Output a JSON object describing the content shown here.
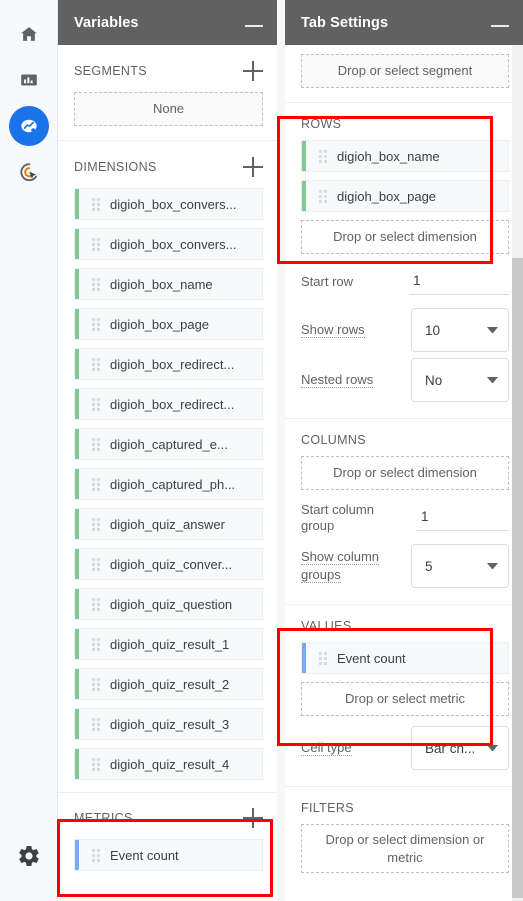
{
  "rail": {
    "items": [
      {
        "name": "home-icon",
        "label": "Home",
        "active": false
      },
      {
        "name": "reports-icon",
        "label": "Reports",
        "active": false
      },
      {
        "name": "explore-icon",
        "label": "Explore",
        "active": true
      },
      {
        "name": "advertising-icon",
        "label": "Advertising",
        "active": false
      }
    ],
    "settings": {
      "name": "gear-icon",
      "label": "Admin"
    }
  },
  "variables_panel": {
    "title": "Variables",
    "minimize_label": "Minimize",
    "segments": {
      "title": "SEGMENTS",
      "add_label": "Add segment",
      "items": [
        "None"
      ]
    },
    "dimensions": {
      "title": "DIMENSIONS",
      "add_label": "Add dimension",
      "items": [
        "digioh_box_convers...",
        "digioh_box_convers...",
        "digioh_box_name",
        "digioh_box_page",
        "digioh_box_redirect...",
        "digioh_box_redirect...",
        "digioh_captured_e...",
        "digioh_captured_ph...",
        "digioh_quiz_answer",
        "digioh_quiz_conver...",
        "digioh_quiz_question",
        "digioh_quiz_result_1",
        "digioh_quiz_result_2",
        "digioh_quiz_result_3",
        "digioh_quiz_result_4"
      ]
    },
    "metrics": {
      "title": "METRICS",
      "add_label": "Add metric",
      "items": [
        "Event count"
      ]
    }
  },
  "tab_settings_panel": {
    "title": "Tab Settings",
    "minimize_label": "Minimize",
    "segment_dropzone": "Drop or select segment",
    "rows": {
      "title": "ROWS",
      "items": [
        "digioh_box_name",
        "digioh_box_page"
      ],
      "dropzone": "Drop or select dimension",
      "start_row": {
        "label": "Start row",
        "value": "1"
      },
      "show_rows": {
        "label": "Show rows",
        "value": "10"
      },
      "nested_rows": {
        "label": "Nested rows",
        "value": "No"
      }
    },
    "columns": {
      "title": "COLUMNS",
      "dropzone": "Drop or select dimension",
      "start_column_group": {
        "label": "Start column group",
        "value": "1"
      },
      "show_column_groups": {
        "label": "Show column groups",
        "value": "5"
      }
    },
    "values": {
      "title": "VALUES",
      "items": [
        "Event count"
      ],
      "dropzone": "Drop or select metric",
      "cell_type": {
        "label": "Cell type",
        "value": "Bar ch..."
      }
    },
    "filters": {
      "title": "FILTERS",
      "dropzone": "Drop or select dimension or metric"
    }
  },
  "colors": {
    "header_bg": "#616161",
    "accent_blue": "#1a73e8",
    "dimension_accent": "#81c995",
    "metric_accent": "#7baaf7",
    "highlight_red": "#ff0000"
  }
}
